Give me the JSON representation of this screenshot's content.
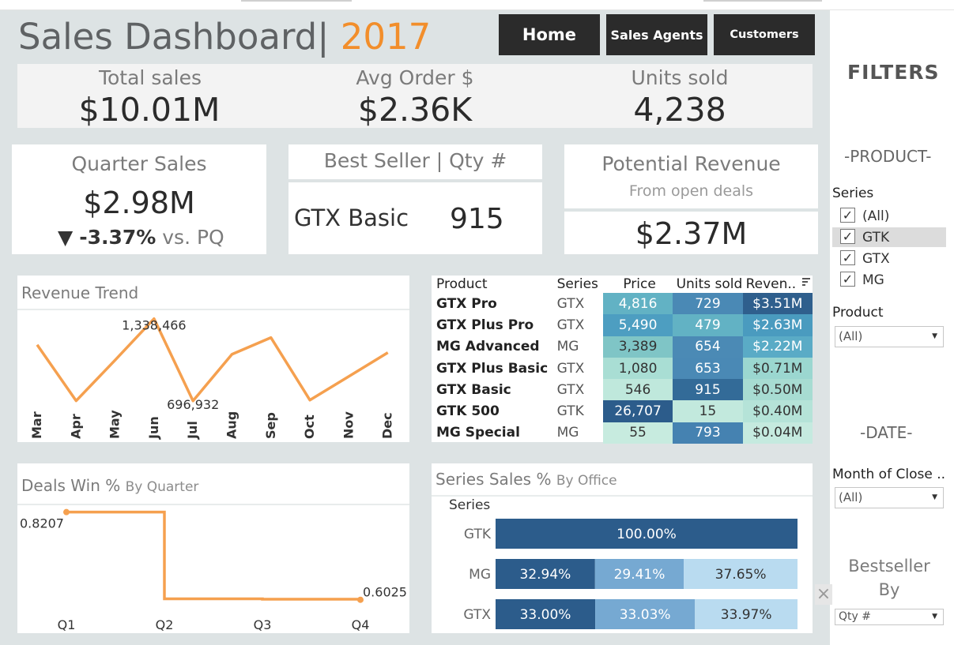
{
  "header": {
    "title": "Sales Dashboard|",
    "year": "2017",
    "nav": [
      {
        "label": "Home"
      },
      {
        "label": "Sales Agents"
      },
      {
        "label": "Customers"
      }
    ]
  },
  "kpis": {
    "total_sales": {
      "label": "Total sales",
      "value": "$10.01M"
    },
    "avg_order": {
      "label": "Avg Order $",
      "value": "$2.36K"
    },
    "units_sold": {
      "label": "Units sold",
      "value": "4,238"
    }
  },
  "quarter_sales": {
    "label": "Quarter Sales",
    "value": "$2.98M",
    "arrow": "▼",
    "change": "-3.37%",
    "vs": "vs. PQ"
  },
  "best_seller": {
    "label": "Best Seller | Qty #",
    "product": "GTX Basic",
    "qty": "915"
  },
  "potential_revenue": {
    "label": "Potential Revenue",
    "sublabel": "From open deals",
    "value": "$2.37M"
  },
  "revenue_trend": {
    "title": "Revenue Trend",
    "chart_data": {
      "type": "line",
      "categories": [
        "Mar",
        "Apr",
        "May",
        "Jun",
        "Jul",
        "Aug",
        "Sep",
        "Oct",
        "Nov",
        "Dec"
      ],
      "values": [
        1135000,
        697600,
        1015000,
        1338466,
        696932,
        1061000,
        1191000,
        703000,
        888000,
        1074000
      ],
      "annotations": [
        "1,338,466",
        "696,932"
      ],
      "color": "#f5a04f"
    }
  },
  "products_table": {
    "columns": [
      "Product",
      "Series",
      "Price",
      "Units sold",
      "Reven.."
    ],
    "sort_icon": "sort-desc-icon",
    "rows": [
      {
        "product": "GTX Pro",
        "series": "GTX",
        "price": "4,816",
        "units": "729",
        "revenue": "$3.51M"
      },
      {
        "product": "GTX Plus Pro",
        "series": "GTX",
        "price": "5,490",
        "units": "479",
        "revenue": "$2.63M"
      },
      {
        "product": "MG Advanced",
        "series": "MG",
        "price": "3,389",
        "units": "654",
        "revenue": "$2.22M"
      },
      {
        "product": "GTX Plus Basic",
        "series": "GTX",
        "price": "1,080",
        "units": "653",
        "revenue": "$0.71M"
      },
      {
        "product": "GTX Basic",
        "series": "GTX",
        "price": "546",
        "units": "915",
        "revenue": "$0.50M"
      },
      {
        "product": "GTK 500",
        "series": "GTK",
        "price": "26,707",
        "units": "15",
        "revenue": "$0.40M"
      },
      {
        "product": "MG Special",
        "series": "MG",
        "price": "55",
        "units": "793",
        "revenue": "$0.04M"
      }
    ],
    "colors": {
      "price": [
        "#62b2c4",
        "#4d9ec1",
        "#7fc5c6",
        "#a9ded4",
        "#bfe8dc",
        "#2c5c8b",
        "#c7ebdf"
      ],
      "units": [
        "#4a89b5",
        "#62b2c4",
        "#4b8ab5",
        "#4a89b5",
        "#336b98",
        "#c2e9dd",
        "#4582b1"
      ],
      "revenue": [
        "#2f5f8d",
        "#4a9bbf",
        "#5aabc6",
        "#9bd7d0",
        "#a7dcd2",
        "#b5e3d8",
        "#c5eadf"
      ]
    }
  },
  "deals_win": {
    "title": "Deals Win %",
    "subtitle": "By Quarter",
    "chart_data": {
      "type": "line",
      "categories": [
        "Q1",
        "Q2",
        "Q3",
        "Q4"
      ],
      "values": [
        0.8207,
        0.605,
        0.604,
        0.6025
      ],
      "annotations": [
        "0.8207",
        "0.6025"
      ],
      "color": "#f5a04f"
    }
  },
  "series_sales": {
    "title": "Series Sales %",
    "subtitle": "By Office",
    "axis_label": "Series",
    "chart_data": {
      "type": "bar",
      "stacked": true,
      "categories": [
        "GTK",
        "MG",
        "GTX"
      ],
      "series": [
        {
          "values": [
            100.0,
            32.94,
            33.0
          ],
          "color": "#2c5c8b"
        },
        {
          "values": [
            0,
            29.41,
            33.03
          ],
          "color": "#76a9d2"
        },
        {
          "values": [
            0,
            37.65,
            33.97
          ],
          "color": "#b9dbf0"
        }
      ],
      "labels": [
        [
          "100.00%"
        ],
        [
          "32.94%",
          "29.41%",
          "37.65%"
        ],
        [
          "33.00%",
          "33.03%",
          "33.97%"
        ]
      ]
    }
  },
  "filters": {
    "title": "FILTERS",
    "product_section": "-PRODUCT-",
    "series_label": "Series",
    "series_options": [
      "(All)",
      "GTK",
      "GTX",
      "MG"
    ],
    "product_label": "Product",
    "product_value": "(All)",
    "date_section": "-DATE-",
    "month_label": "Month of Close ..",
    "month_value": "(All)",
    "bestseller_line1": "Bestseller",
    "bestseller_line2": "By",
    "bestseller_value": "Qty #"
  }
}
